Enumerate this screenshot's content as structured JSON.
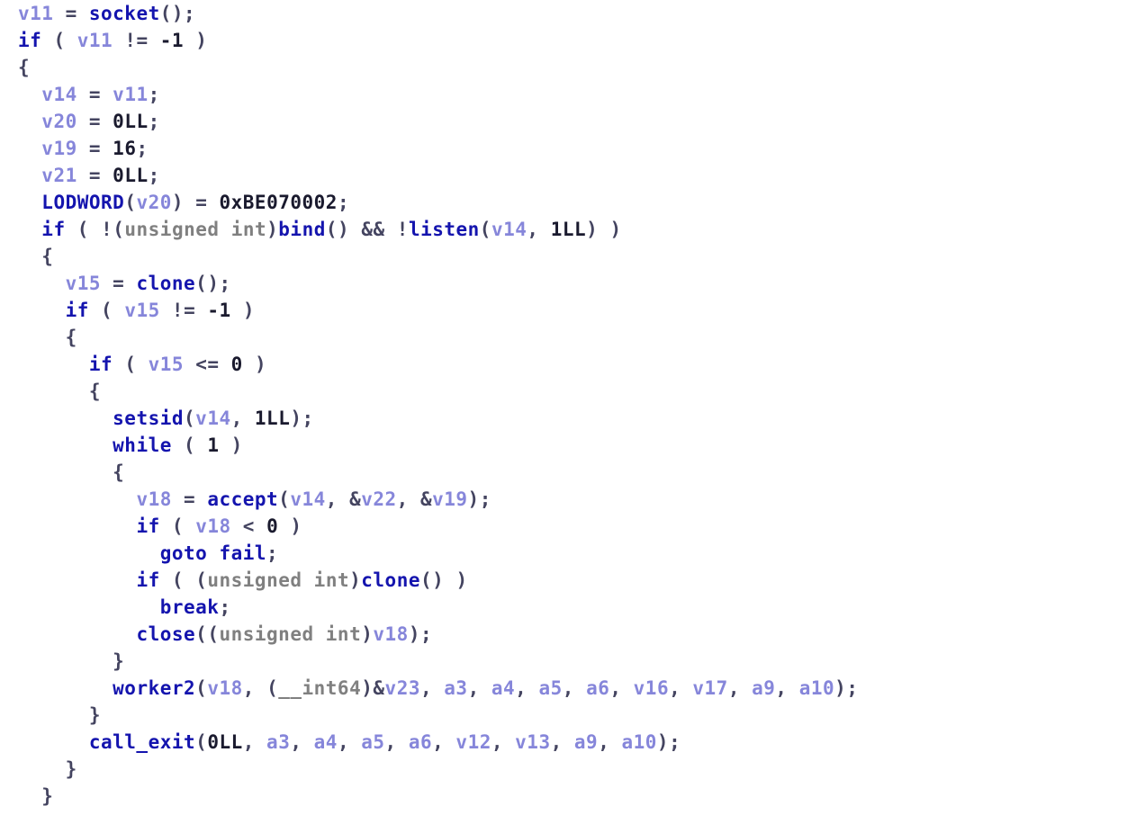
{
  "vars": {
    "v11": "v11",
    "v12": "v12",
    "v13": "v13",
    "v14": "v14",
    "v15": "v15",
    "v16": "v16",
    "v17": "v17",
    "v18": "v18",
    "v19": "v19",
    "v20": "v20",
    "v21": "v21",
    "v22": "v22",
    "v23": "v23",
    "a3": "a3",
    "a4": "a4",
    "a5": "a5",
    "a6": "a6",
    "a9": "a9",
    "a10": "a10"
  },
  "kw": {
    "if": "if",
    "while": "while",
    "goto": "goto",
    "break": "break",
    "socket": "socket",
    "bind": "bind",
    "listen": "listen",
    "clone": "clone",
    "setsid": "setsid",
    "accept": "accept",
    "close": "close",
    "fail": "fail",
    "LODWORD": "LODWORD",
    "worker2": "worker2",
    "call_exit": "call_exit"
  },
  "ty": {
    "unsigned": "unsigned",
    "int": "int",
    "int64": "__int64"
  },
  "num": {
    "neg1": "-1",
    "zero": "0",
    "zeroLL": "0LL",
    "one": "1",
    "oneLL": "1LL",
    "sixteen": "16",
    "hex": "0xBE070002"
  },
  "punct": {
    "eq": " = ",
    "ne": " != ",
    "lbrace": "{",
    "rbrace": "}",
    "lparen": "(",
    "rparen": ")",
    "semi": ";",
    "sp": " ",
    "amp": "&",
    "ampamp": "&&",
    "bang": "!",
    "comma": ", ",
    "lt": " < ",
    "le": " <= ",
    "sp2": "  "
  }
}
